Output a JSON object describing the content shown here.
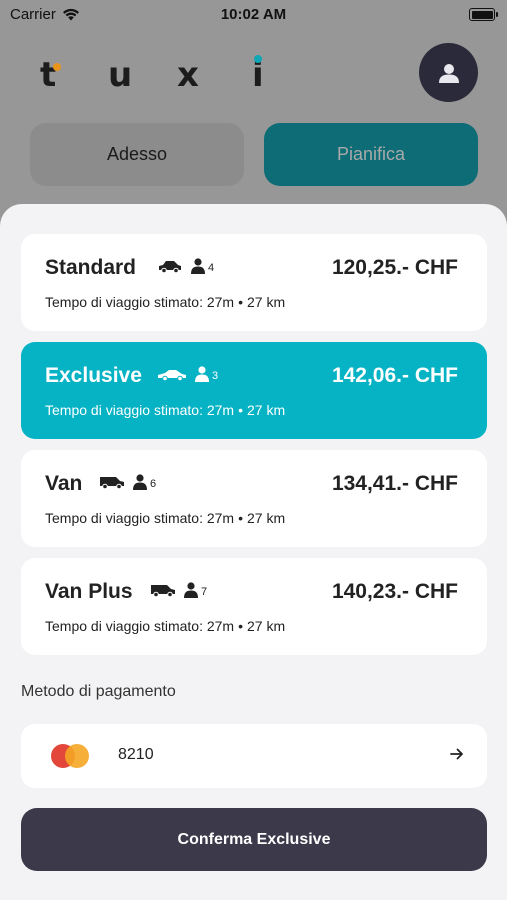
{
  "status_bar": {
    "carrier": "Carrier",
    "time": "10:02 AM"
  },
  "header": {
    "logo_letters": [
      "t",
      "u",
      "x",
      "i"
    ],
    "logo_colors": {
      "t_dot": "#e8941b",
      "i_dot": "#11a6b5"
    },
    "avatar_icon": "user-icon"
  },
  "tabs": [
    {
      "label": "Adesso",
      "selected": false
    },
    {
      "label": "Pianifica",
      "selected": true
    }
  ],
  "options": [
    {
      "name": "Standard",
      "icon": "car-icon",
      "capacity": "4",
      "price": "120,25.- CHF",
      "info": "Tempo di viaggio stimato: 27m",
      "separator": "•",
      "distance": "27 km",
      "selected": false
    },
    {
      "name": "Exclusive",
      "icon": "sports-car-icon",
      "capacity": "3",
      "price": "142,06.- CHF",
      "info": "Tempo di viaggio stimato: 27m",
      "separator": "•",
      "distance": "27 km",
      "selected": true
    },
    {
      "name": "Van",
      "icon": "van-icon",
      "capacity": "6",
      "price": "134,41.- CHF",
      "info": "Tempo di viaggio stimato: 27m",
      "separator": "•",
      "distance": "27 km",
      "selected": false
    },
    {
      "name": "Van Plus",
      "icon": "van-icon",
      "capacity": "7",
      "price": "140,23.- CHF",
      "info": "Tempo di viaggio stimato: 27m",
      "separator": "•",
      "distance": "27 km",
      "selected": false
    }
  ],
  "payment": {
    "label": "Metodo di pagamento",
    "card_brand_icon": "mastercard-icon",
    "card_digits": "8210"
  },
  "confirm": {
    "label": "Conferma Exclusive"
  },
  "colors": {
    "accent": "#05b3c4",
    "dark": "#3b394a",
    "sheet": "#f3f3f5"
  }
}
